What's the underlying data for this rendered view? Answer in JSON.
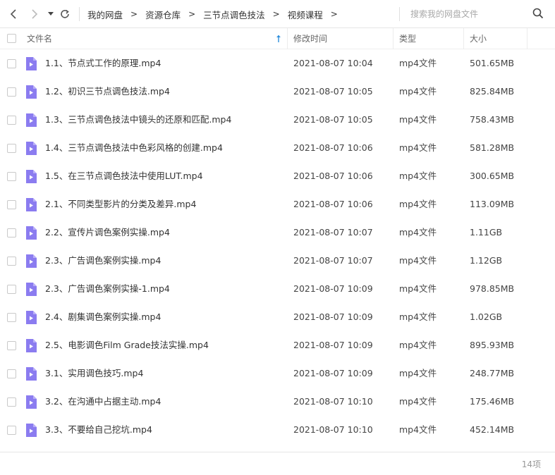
{
  "toolbar": {
    "breadcrumbs": [
      "我的网盘",
      "资源仓库",
      "三节点调色技法",
      "视频课程"
    ],
    "separator": ">",
    "search_placeholder": "搜索我的网盘文件"
  },
  "table": {
    "columns": {
      "name": "文件名",
      "modified": "修改时间",
      "type": "类型",
      "size": "大小"
    },
    "rows": [
      {
        "name": "1.1、节点式工作的原理.mp4",
        "modified": "2021-08-07 10:04",
        "type": "mp4文件",
        "size": "501.65MB"
      },
      {
        "name": "1.2、初识三节点调色技法.mp4",
        "modified": "2021-08-07 10:05",
        "type": "mp4文件",
        "size": "825.84MB"
      },
      {
        "name": "1.3、三节点调色技法中镜头的还原和匹配.mp4",
        "modified": "2021-08-07 10:05",
        "type": "mp4文件",
        "size": "758.43MB"
      },
      {
        "name": "1.4、三节点调色技法中色彩风格的创建.mp4",
        "modified": "2021-08-07 10:06",
        "type": "mp4文件",
        "size": "581.28MB"
      },
      {
        "name": "1.5、在三节点调色技法中使用LUT.mp4",
        "modified": "2021-08-07 10:06",
        "type": "mp4文件",
        "size": "300.65MB"
      },
      {
        "name": "2.1、不同类型影片的分类及差异.mp4",
        "modified": "2021-08-07 10:06",
        "type": "mp4文件",
        "size": "113.09MB"
      },
      {
        "name": "2.2、宣传片调色案例实操.mp4",
        "modified": "2021-08-07 10:07",
        "type": "mp4文件",
        "size": "1.11GB"
      },
      {
        "name": "2.3、广告调色案例实操.mp4",
        "modified": "2021-08-07 10:07",
        "type": "mp4文件",
        "size": "1.12GB"
      },
      {
        "name": "2.3、广告调色案例实操-1.mp4",
        "modified": "2021-08-07 10:09",
        "type": "mp4文件",
        "size": "978.85MB"
      },
      {
        "name": "2.4、剧集调色案例实操.mp4",
        "modified": "2021-08-07 10:09",
        "type": "mp4文件",
        "size": "1.02GB"
      },
      {
        "name": "2.5、电影调色Film Grade技法实操.mp4",
        "modified": "2021-08-07 10:09",
        "type": "mp4文件",
        "size": "895.93MB"
      },
      {
        "name": "3.1、实用调色技巧.mp4",
        "modified": "2021-08-07 10:09",
        "type": "mp4文件",
        "size": "248.77MB"
      },
      {
        "name": "3.2、在沟通中占据主动.mp4",
        "modified": "2021-08-07 10:10",
        "type": "mp4文件",
        "size": "175.46MB"
      },
      {
        "name": "3.3、不要给自己挖坑.mp4",
        "modified": "2021-08-07 10:10",
        "type": "mp4文件",
        "size": "452.14MB"
      }
    ]
  },
  "footer": {
    "count": "14项"
  },
  "icons": {
    "back": "chevron-left-icon",
    "forward": "chevron-right-icon",
    "dropdown": "caret-down-icon",
    "refresh": "refresh-icon",
    "search": "search-icon",
    "file": "video-file-icon",
    "sort": "sort-ascending-icon"
  },
  "colors": {
    "file_icon": "#8b7cf0",
    "sort_arrow": "#2c8ddb"
  }
}
